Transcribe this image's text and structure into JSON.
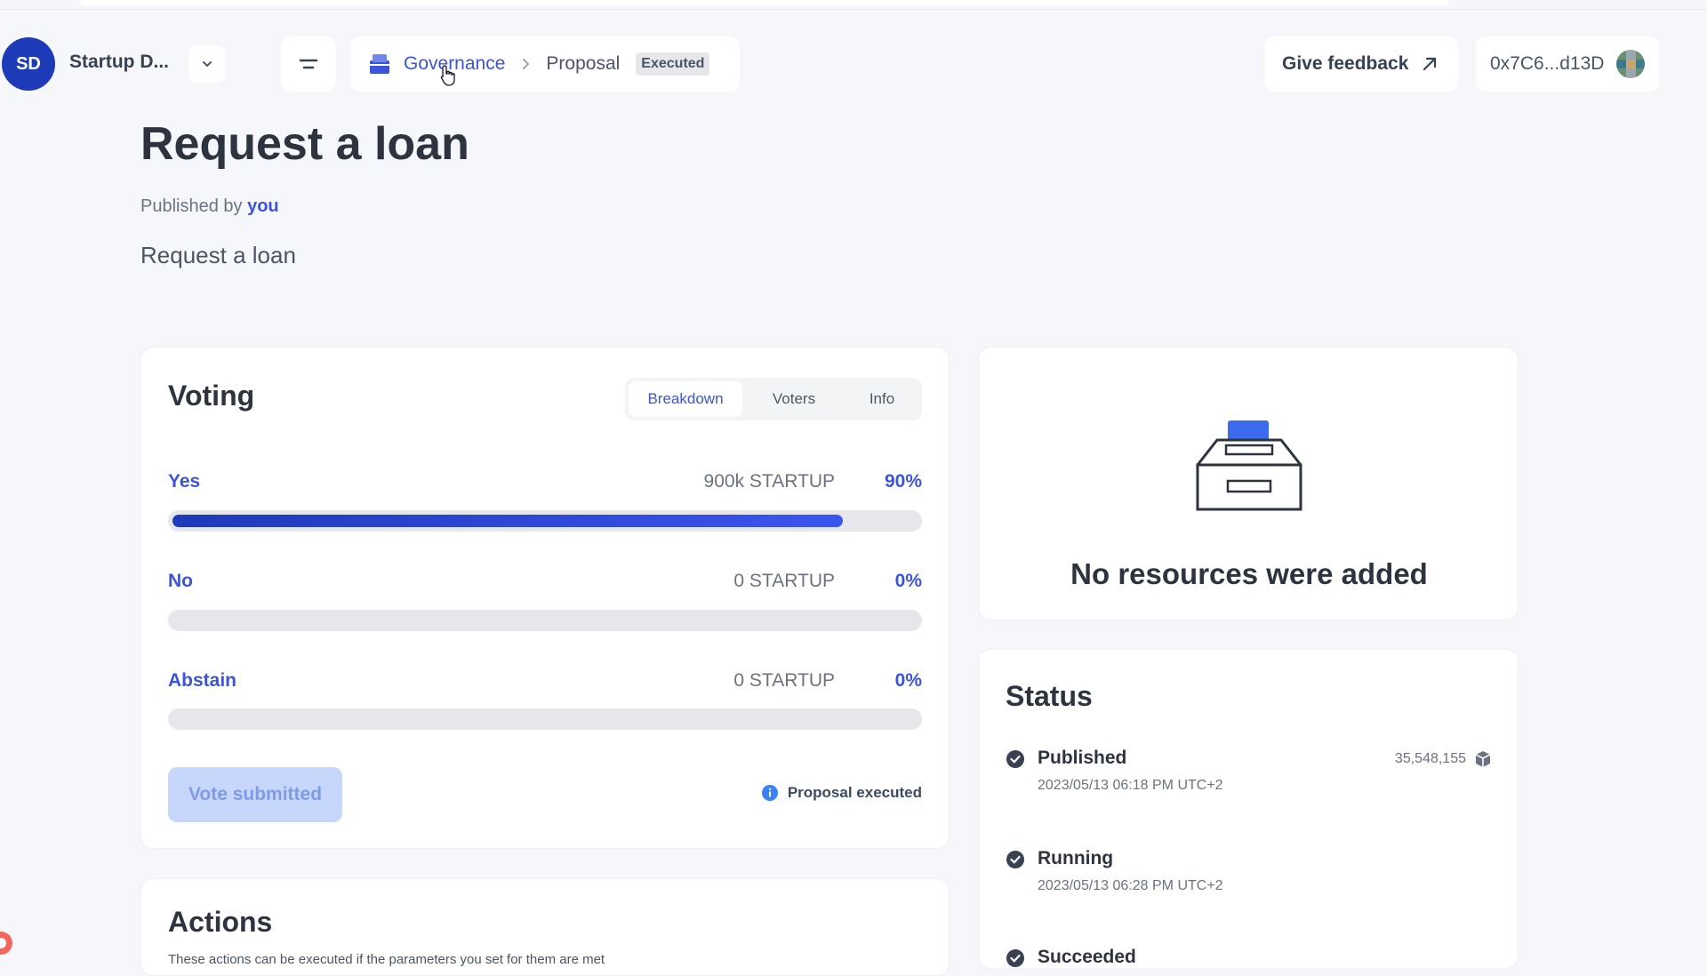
{
  "header": {
    "dao_initials": "SD",
    "dao_name": "Startup D...",
    "breadcrumb": {
      "governance": "Governance",
      "proposal": "Proposal",
      "badge": "Executed"
    },
    "feedback_label": "Give feedback",
    "wallet_address": "0x7C6...d13D"
  },
  "proposal": {
    "title": "Request a loan",
    "published_prefix": "Published by",
    "published_by": "you",
    "summary": "Request a loan"
  },
  "voting": {
    "title": "Voting",
    "tabs": [
      "Breakdown",
      "Voters",
      "Info"
    ],
    "active_tab": "Breakdown",
    "options": [
      {
        "label": "Yes",
        "amount": "900k STARTUP",
        "percent": "90%",
        "fraction": 0.9
      },
      {
        "label": "No",
        "amount": "0 STARTUP",
        "percent": "0%",
        "fraction": 0
      },
      {
        "label": "Abstain",
        "amount": "0 STARTUP",
        "percent": "0%",
        "fraction": 0
      }
    ],
    "vote_button": "Vote submitted",
    "executed_note": "Proposal executed"
  },
  "resources": {
    "empty_text": "No resources were added"
  },
  "status": {
    "title": "Status",
    "items": [
      {
        "name": "Published",
        "date": "2023/05/13 06:18 PM UTC+2",
        "block": "35,548,155"
      },
      {
        "name": "Running",
        "date": "2023/05/13 06:28 PM UTC+2",
        "block": ""
      },
      {
        "name": "Succeeded",
        "date": "",
        "block": ""
      }
    ]
  },
  "actions": {
    "title": "Actions",
    "description": "These actions can be executed if the parameters you set for them are met"
  },
  "colors": {
    "accent": "#3b55d6",
    "dao_avatar": "#1d3ab8",
    "vote_button_bg": "#c7d7fb"
  }
}
